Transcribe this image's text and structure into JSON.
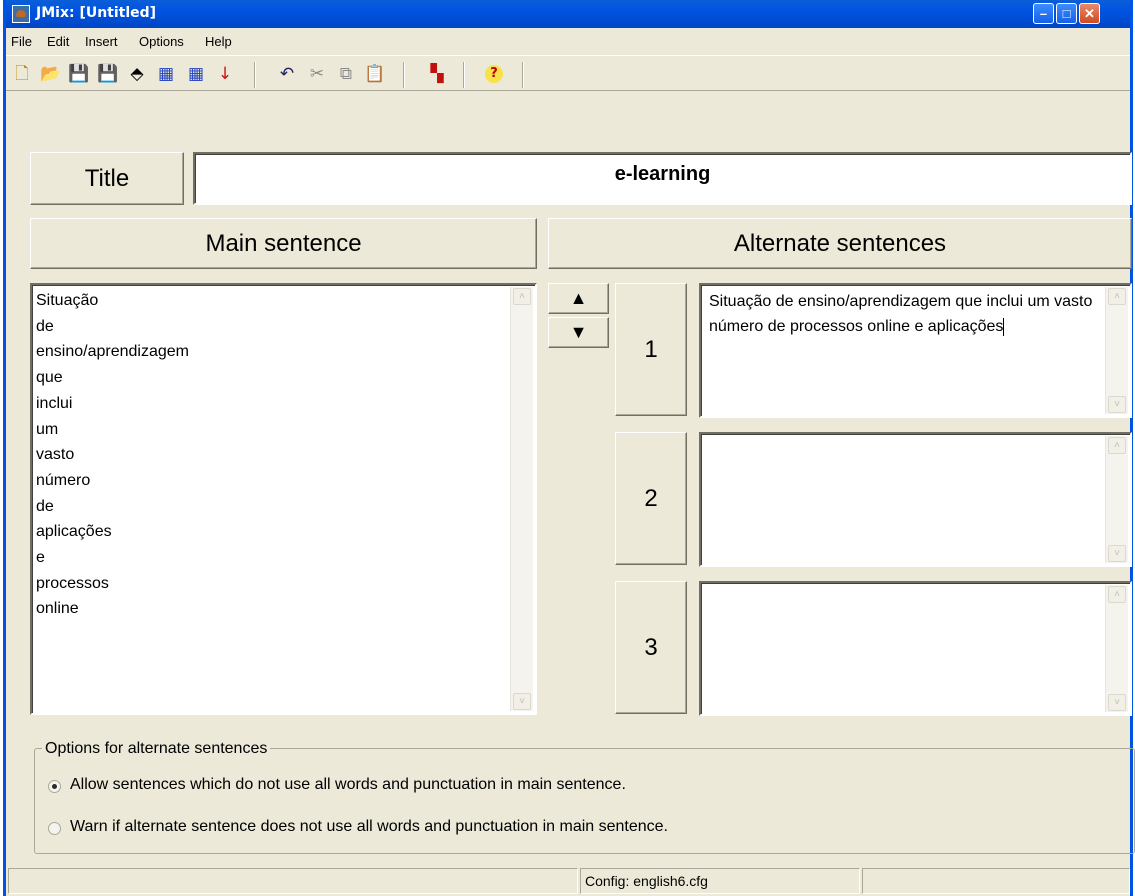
{
  "window": {
    "title": "JMix: [Untitled]",
    "min_glyph": "–",
    "max_glyph": "□",
    "close_glyph": "✕"
  },
  "menu": [
    "File",
    "Edit",
    "Insert",
    "Options",
    "Help"
  ],
  "toolbar": [
    {
      "icon": "new-icon",
      "glyph": "🗋",
      "color": "#c08a00"
    },
    {
      "icon": "open-icon",
      "glyph": "📂",
      "color": "#000000"
    },
    {
      "icon": "save-icon",
      "glyph": "💾",
      "color": "#000000"
    },
    {
      "icon": "save-as-icon",
      "glyph": "💾",
      "color": "#3050c0"
    },
    {
      "icon": "clear-icon",
      "glyph": "⬘",
      "color": "#000000"
    },
    {
      "icon": "export-web-icon",
      "glyph": "▦",
      "color": "#2040c0"
    },
    {
      "icon": "export-web2-icon",
      "glyph": "▦",
      "color": "#2040c0"
    },
    {
      "icon": "add-to-queue-icon",
      "glyph": "↓",
      "color": "#d01010"
    },
    {
      "icon": "undo-icon",
      "glyph": "↶",
      "color": "#202060"
    },
    {
      "icon": "cut-icon",
      "glyph": "✂",
      "color": "#8a8a8a"
    },
    {
      "icon": "copy-icon",
      "glyph": "⧉",
      "color": "#8a8a8a"
    },
    {
      "icon": "paste-icon",
      "glyph": "📋",
      "color": "#303030"
    },
    {
      "icon": "config-icon",
      "glyph": "▚",
      "color": "#c01010"
    },
    {
      "icon": "help-icon",
      "glyph": "?",
      "color": "#c00000"
    }
  ],
  "title_label": "Title",
  "title_value": "e-learning",
  "main_header": "Main sentence",
  "alt_header": "Alternate sentences",
  "main_words": [
    "Situação",
    "de",
    "ensino/aprendizagem",
    "que",
    "inclui",
    "um",
    "vasto",
    "número",
    "de",
    "aplicações",
    "e",
    "processos",
    "online"
  ],
  "alternates": [
    {
      "number": "1",
      "text": "Situação de ensino/aprendizagem que inclui um vasto número de processos online e aplicações"
    },
    {
      "number": "2",
      "text": ""
    },
    {
      "number": "3",
      "text": ""
    }
  ],
  "move_up_glyph": "▲",
  "move_down_glyph": "▼",
  "scroll_up_glyph": "˄",
  "scroll_down_glyph": "˅",
  "options": {
    "legend": "Options for alternate sentences",
    "allow": "Allow sentences which do not use all words and punctuation in main sentence.",
    "warn": "Warn if alternate sentence does not use all words and punctuation in main sentence.",
    "selected": "allow"
  },
  "status": {
    "left": "",
    "config": "Config: english6.cfg",
    "right": ""
  }
}
